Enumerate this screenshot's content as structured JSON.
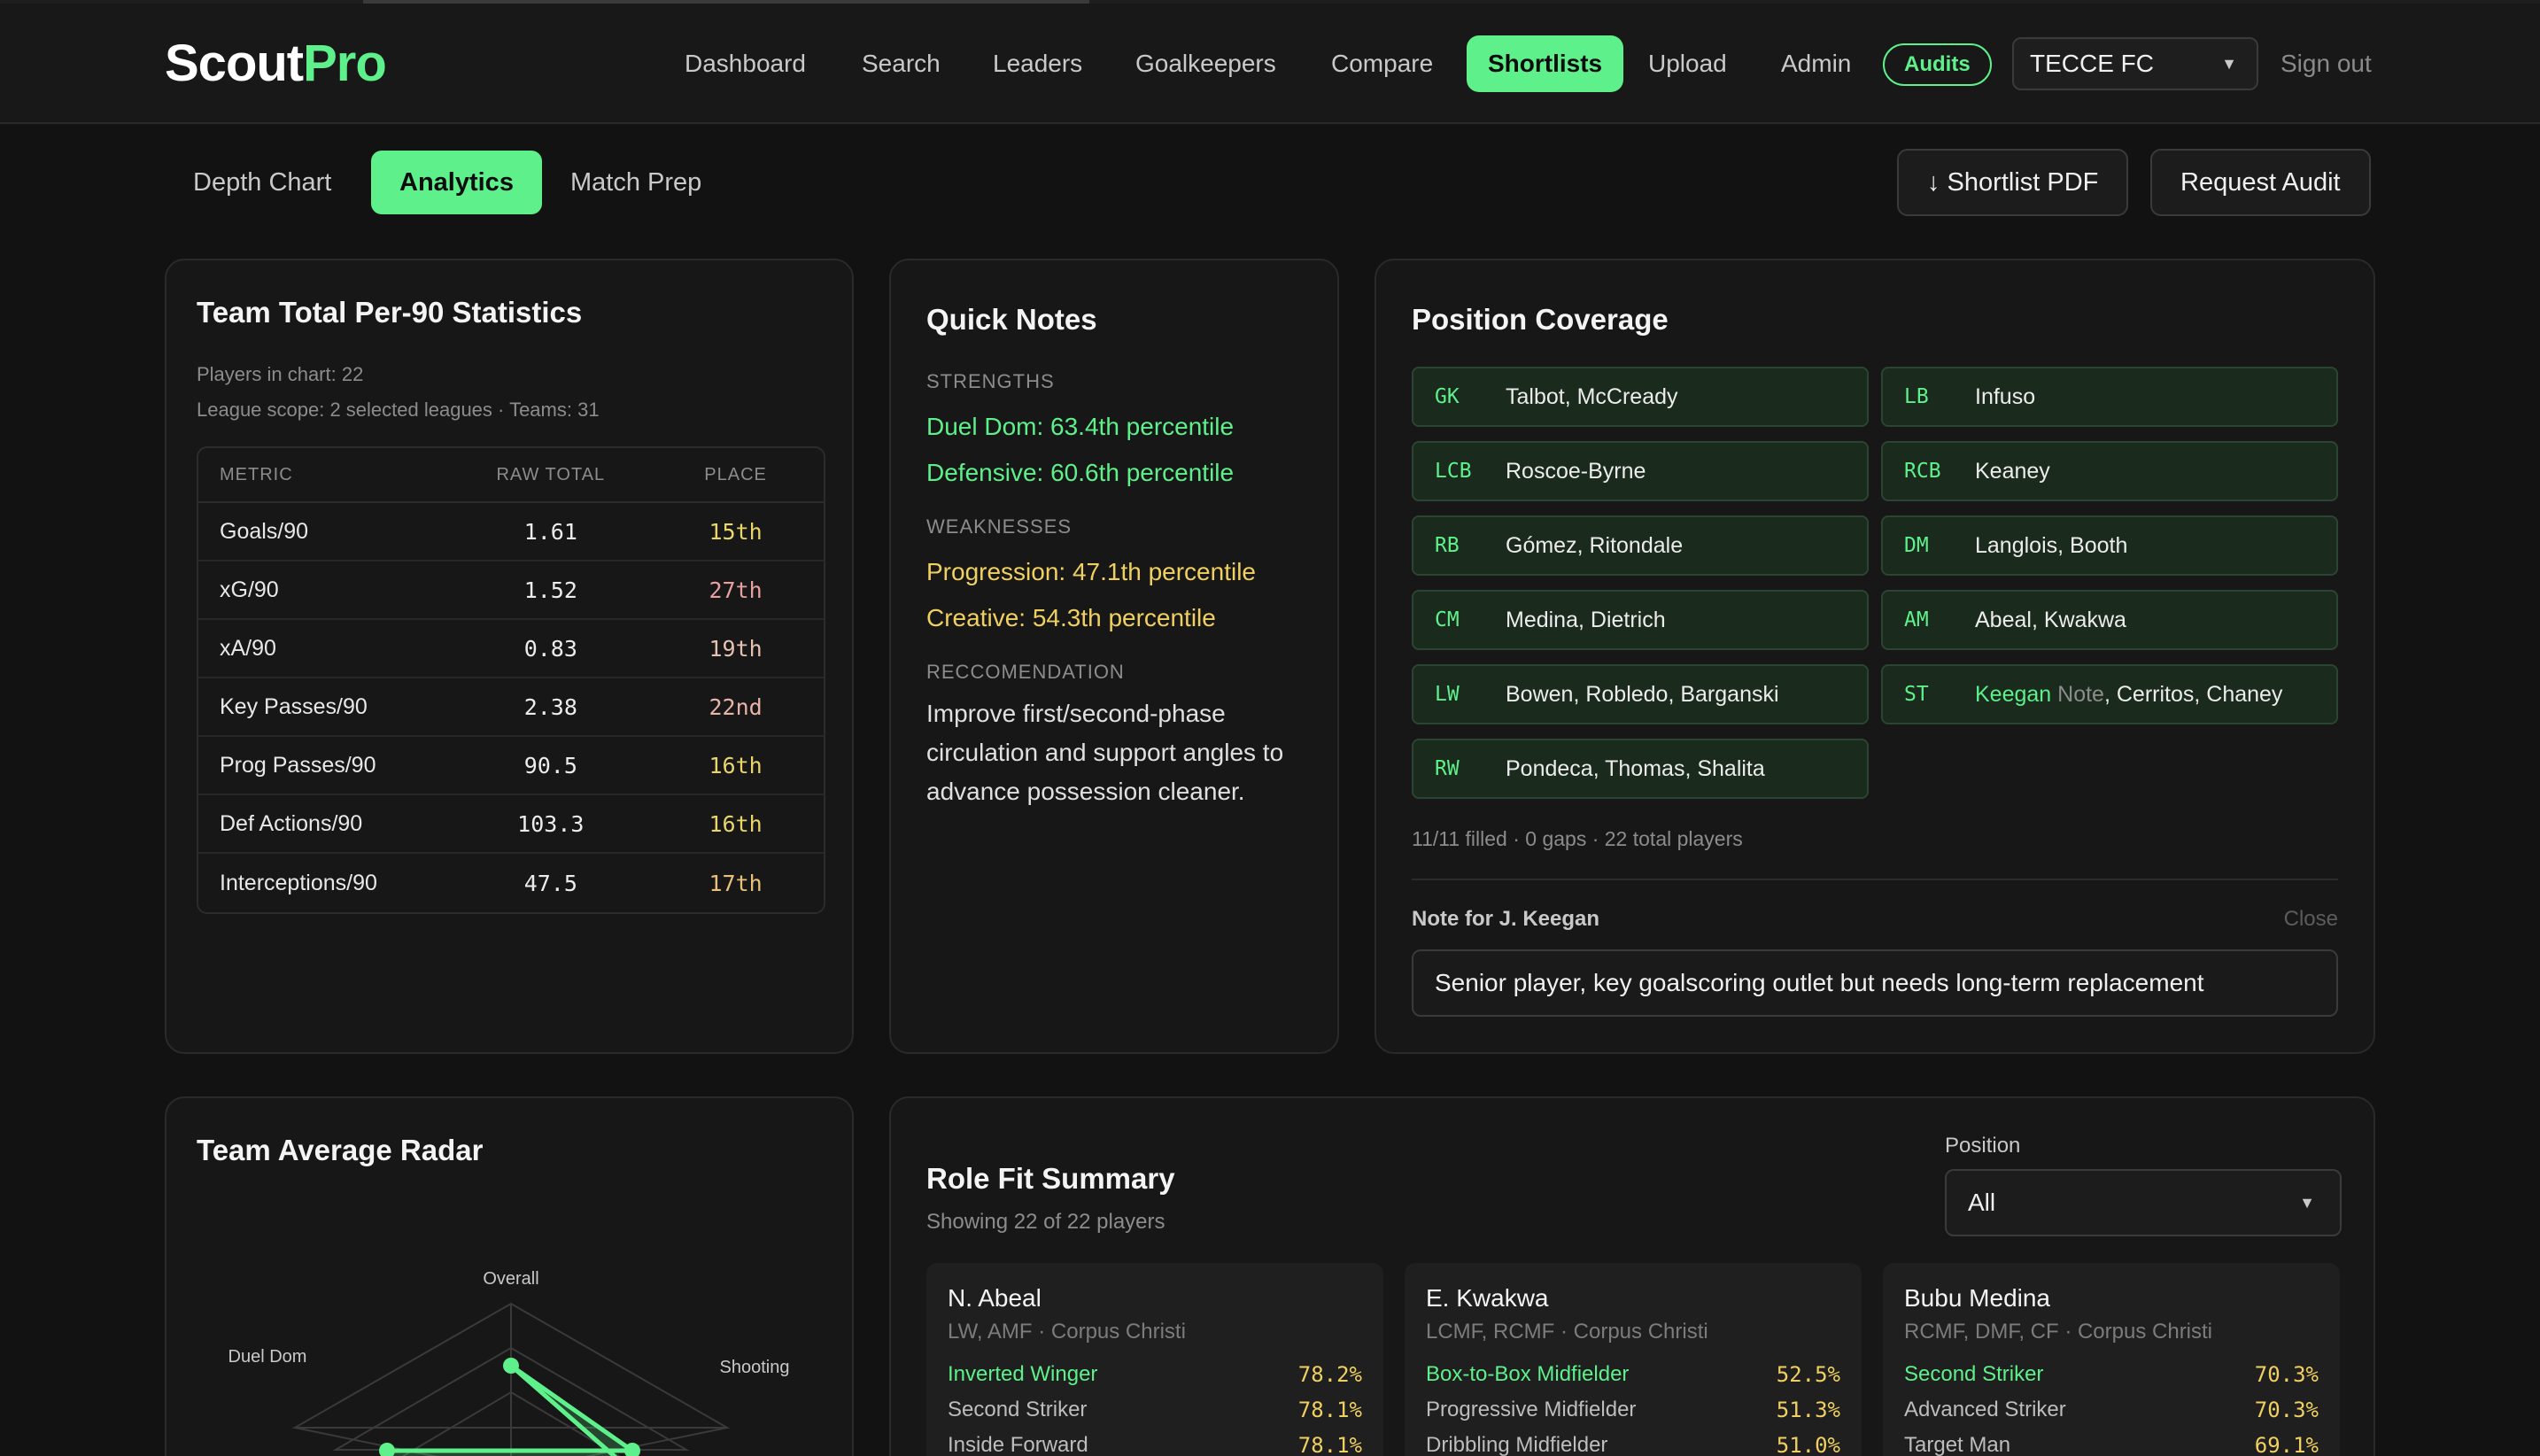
{
  "app": {
    "logo_main": "Scout",
    "logo_accent": "Pro",
    "accent_color": "#5ef08a"
  },
  "nav": {
    "items": [
      "Dashboard",
      "Search",
      "Leaders",
      "Goalkeepers",
      "Compare",
      "Shortlists",
      "Upload",
      "Admin"
    ],
    "active": "Shortlists",
    "audits_label": "Audits",
    "team_select": "TECCE FC",
    "signout": "Sign out"
  },
  "subtabs": {
    "items": [
      "Depth Chart",
      "Analytics",
      "Match Prep"
    ],
    "active": "Analytics"
  },
  "actions": {
    "shortlist_pdf": "↓ Shortlist PDF",
    "request_audit": "Request Audit"
  },
  "stats": {
    "title": "Team Total Per-90 Statistics",
    "players_line": "Players in chart: 22",
    "scope_line": "League scope: 2 selected leagues · Teams: 31",
    "headers": [
      "METRIC",
      "RAW TOTAL",
      "PLACE"
    ],
    "rows": [
      {
        "metric": "Goals/90",
        "raw": "1.61",
        "place": "15th",
        "color": "#e8d66a"
      },
      {
        "metric": "xG/90",
        "raw": "1.52",
        "place": "27th",
        "color": "#e8a0a0"
      },
      {
        "metric": "xA/90",
        "raw": "0.83",
        "place": "19th",
        "color": "#e8c2b0"
      },
      {
        "metric": "Key Passes/90",
        "raw": "2.38",
        "place": "22nd",
        "color": "#e8b4a8"
      },
      {
        "metric": "Prog Passes/90",
        "raw": "90.5",
        "place": "16th",
        "color": "#e8d66a"
      },
      {
        "metric": "Def Actions/90",
        "raw": "103.3",
        "place": "16th",
        "color": "#e8d66a"
      },
      {
        "metric": "Interceptions/90",
        "raw": "47.5",
        "place": "17th",
        "color": "#e8c27a"
      }
    ]
  },
  "notes": {
    "title": "Quick Notes",
    "strengths_label": "STRENGTHS",
    "strengths": [
      "Duel Dom: 63.4th percentile",
      "Defensive: 60.6th percentile"
    ],
    "weaknesses_label": "WEAKNESSES",
    "weaknesses": [
      "Progression: 47.1th percentile",
      "Creative: 54.3th percentile"
    ],
    "rec_label": "RECCOMENDATION",
    "recommendation": "Improve first/second-phase circulation and support angles to advance possession cleaner.",
    "strength_color": "#5ef08a",
    "weakness_color": "#f0d060"
  },
  "coverage": {
    "title": "Position Coverage",
    "positions": [
      {
        "pos": "GK",
        "names": "Talbot, McCready"
      },
      {
        "pos": "LB",
        "names": "Infuso"
      },
      {
        "pos": "LCB",
        "names": "Roscoe-Byrne"
      },
      {
        "pos": "RCB",
        "names": "Keaney"
      },
      {
        "pos": "RB",
        "names": "Gómez, Ritondale"
      },
      {
        "pos": "DM",
        "names": "Langlois, Booth"
      },
      {
        "pos": "CM",
        "names": "Medina, Dietrich"
      },
      {
        "pos": "AM",
        "names": "Abeal, Kwakwa"
      },
      {
        "pos": "LW",
        "names": "Bowen, Robledo, Barganski"
      },
      {
        "pos": "ST",
        "names_highlight": "Keegan",
        "names_note": "Note",
        "names_rest": ", Cerritos, Chaney"
      },
      {
        "pos": "RW",
        "names": "Pondeca, Thomas, Shalita"
      }
    ],
    "summary": "11/11 filled · 0 gaps · 22 total players",
    "note_label": "Note for J. Keegan",
    "note_close": "Close",
    "note_value": "Senior player, key goalscoring outlet but needs long-term replacement"
  },
  "radar": {
    "title": "Team Average Radar",
    "axes": [
      "Overall",
      "Shooting",
      "Duel Dom"
    ]
  },
  "rolefit": {
    "title": "Role Fit Summary",
    "subtitle": "Showing 22 of 22 players",
    "position_label": "Position",
    "position_value": "All",
    "players": [
      {
        "name": "N. Abeal",
        "sub": "LW, AMF · Corpus Christi",
        "roles": [
          {
            "role": "Inverted Winger",
            "value": "78.2%"
          },
          {
            "role": "Second Striker",
            "value": "78.1%"
          },
          {
            "role": "Inside Forward",
            "value": "78.1%"
          }
        ]
      },
      {
        "name": "E. Kwakwa",
        "sub": "LCMF, RCMF · Corpus Christi",
        "roles": [
          {
            "role": "Box-to-Box Midfielder",
            "value": "52.5%"
          },
          {
            "role": "Progressive Midfielder",
            "value": "51.3%"
          },
          {
            "role": "Dribbling Midfielder",
            "value": "51.0%"
          }
        ]
      },
      {
        "name": "Bubu Medina",
        "sub": "RCMF, DMF, CF · Corpus Christi",
        "roles": [
          {
            "role": "Second Striker",
            "value": "70.3%"
          },
          {
            "role": "Advanced Striker",
            "value": "70.3%"
          },
          {
            "role": "Target Man",
            "value": "69.1%"
          }
        ]
      }
    ],
    "value_color_green": "#5ef08a",
    "value_color_yellow": "#f0d060"
  }
}
